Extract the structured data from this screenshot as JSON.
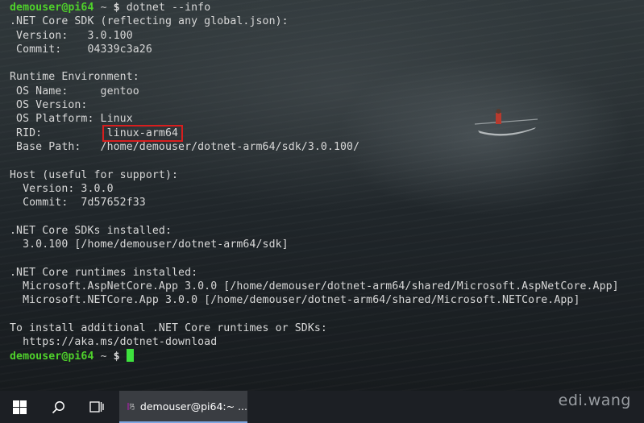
{
  "terminal": {
    "prompt": {
      "user_host": "demouser@pi64",
      "path": "~",
      "symbol": "$"
    },
    "command": "dotnet --info",
    "output": [
      ".NET Core SDK (reflecting any global.json):",
      " Version:   3.0.100",
      " Commit:    04339c3a26",
      "",
      "Runtime Environment:",
      " OS Name:     gentoo",
      " OS Version:",
      " OS Platform: Linux",
      " RID:",
      " Base Path:   /home/demouser/dotnet-arm64/sdk/3.0.100/",
      "",
      "Host (useful for support):",
      "  Version: 3.0.0",
      "  Commit:  7d57652f33",
      "",
      ".NET Core SDKs installed:",
      "  3.0.100 [/home/demouser/dotnet-arm64/sdk]",
      "",
      ".NET Core runtimes installed:",
      "  Microsoft.AspNetCore.App 3.0.0 [/home/demouser/dotnet-arm64/shared/Microsoft.AspNetCore.App]",
      "  Microsoft.NETCore.App 3.0.0 [/home/demouser/dotnet-arm64/shared/Microsoft.NETCore.App]",
      "",
      "To install additional .NET Core runtimes or SDKs:",
      "  https://aka.ms/dotnet-download"
    ],
    "rid_value": "linux-arm64",
    "highlight_color": "#d81e1e",
    "prompt_color": "#4fd12b",
    "cursor_color": "#3ee23e"
  },
  "taskbar": {
    "start_icon": "windows-logo-icon",
    "search_icon": "search-icon",
    "task_view_icon": "task-view-icon",
    "app_button_label": "demouser@pi64:~ ...",
    "app_icon": "terminal-app-icon"
  },
  "watermark": "edi.wang"
}
